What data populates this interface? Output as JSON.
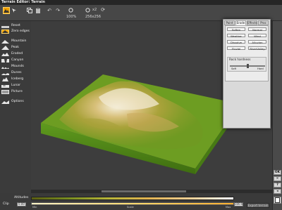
{
  "window": {
    "title": "Terrain Editor: Terrain"
  },
  "toolbar": {
    "zoom_value": "100%",
    "size_multiplier": "x2",
    "size_value": "256x256"
  },
  "left_panel": {
    "items": [
      {
        "label": "Reset",
        "icon": "reset-icon"
      },
      {
        "label": "Zero edges",
        "icon": "zero-edges-icon"
      },
      {
        "label": "Mountain",
        "icon": "mountain-icon"
      },
      {
        "label": "Peak",
        "icon": "peak-icon"
      },
      {
        "label": "Eroded",
        "icon": "eroded-icon"
      },
      {
        "label": "Canyon",
        "icon": "canyon-icon"
      },
      {
        "label": "Mounds",
        "icon": "mounds-icon"
      },
      {
        "label": "Dunes",
        "icon": "dunes-icon"
      },
      {
        "label": "Iceberg",
        "icon": "iceberg-icon"
      },
      {
        "label": "Lunar",
        "icon": "lunar-icon"
      },
      {
        "label": "Picture",
        "icon": "picture-icon"
      },
      {
        "label": "Options",
        "icon": "options-icon"
      }
    ]
  },
  "erode_panel": {
    "tabs": [
      "Paint",
      "Erode",
      "Effects",
      "Proc"
    ],
    "active_tab": "Erode",
    "buttons": [
      {
        "label": "Soften"
      },
      {
        "label": "Normal"
      },
      {
        "label": "Weather"
      },
      {
        "label": "Wind"
      },
      {
        "label": "Dissolve"
      },
      {
        "label": "Alluvion"
      },
      {
        "label": "Fluvial"
      },
      {
        "label": "RiverValley"
      }
    ],
    "rock_hardness": {
      "label": "Rock hardness",
      "min_label": "Soft",
      "max_label": "Hard",
      "value": 0.5
    }
  },
  "right_strip": {
    "buttons": [
      {
        "label": "OK"
      },
      {
        "label": "✕"
      },
      {
        "label": "?"
      },
      {
        "label": "◂"
      }
    ]
  },
  "bottom": {
    "altitudes_label": "Altitudes",
    "clip_label": "Clip",
    "clip_min": "0.00",
    "clip_max": "100.0",
    "scale_min_label": "Min",
    "scale_mid_label": "Scale",
    "scale_max_label": "Max",
    "action_button": "Export terrain"
  },
  "colors": {
    "active_tool": "#f0a000",
    "panel_bg": "#d9d9d9",
    "viewport_bg": "#3d3d3d"
  }
}
